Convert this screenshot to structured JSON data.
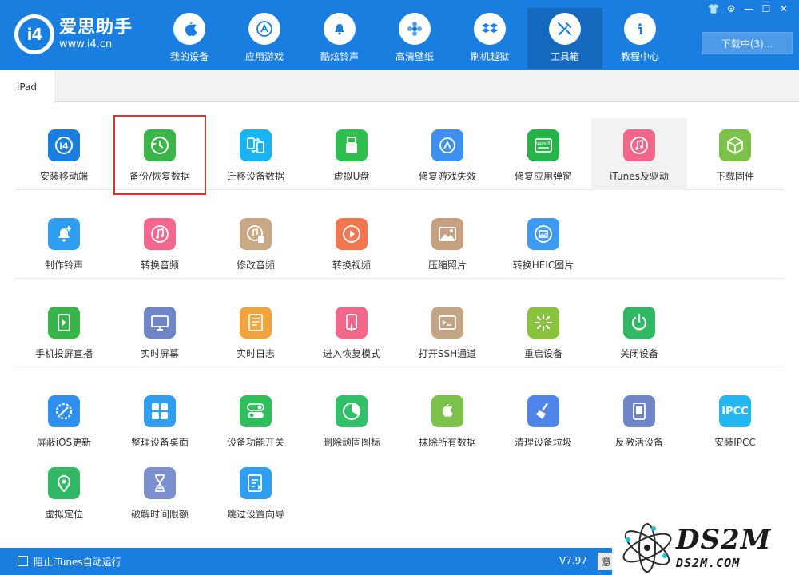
{
  "app": {
    "logo_mark": "i4",
    "name": "爱思助手",
    "url": "www.i4.cn"
  },
  "nav": [
    {
      "label": "我的设备",
      "icon": "apple-icon",
      "active": false
    },
    {
      "label": "应用游戏",
      "icon": "app-store-icon",
      "active": false
    },
    {
      "label": "酷炫铃声",
      "icon": "bell-icon",
      "active": false
    },
    {
      "label": "高清壁纸",
      "icon": "flower-icon",
      "active": false
    },
    {
      "label": "刷机越狱",
      "icon": "dropbox-icon",
      "active": false
    },
    {
      "label": "工具箱",
      "icon": "tools-icon",
      "active": true
    },
    {
      "label": "教程中心",
      "icon": "info-icon",
      "active": false
    }
  ],
  "window_controls": [
    "👕",
    "⚙",
    "—",
    "☐",
    "✕"
  ],
  "download_button": "下载中(3)...",
  "tab": "iPad",
  "tools": [
    [
      {
        "label": "安装移动端",
        "icon": "i4-app-icon",
        "color": "#1a7ee0"
      },
      {
        "label": "备份/恢复数据",
        "icon": "backup-restore-icon",
        "color": "#3bb54a",
        "selected": true
      },
      {
        "label": "迁移设备数据",
        "icon": "migrate-data-icon",
        "color": "#18b3f0"
      },
      {
        "label": "虚拟U盘",
        "icon": "usb-drive-icon",
        "color": "#2fbf4f"
      },
      {
        "label": "修复游戏失效",
        "icon": "repair-app-icon",
        "color": "#3d8ff0"
      },
      {
        "label": "修复应用弹窗",
        "icon": "apple-id-icon",
        "color": "#28b24a"
      },
      {
        "label": "iTunes及驱动",
        "icon": "itunes-icon",
        "color": "#f2668b",
        "hover": true
      },
      {
        "label": "下载固件",
        "icon": "cube-icon",
        "color": "#7cc24a"
      }
    ],
    [
      {
        "label": "制作铃声",
        "icon": "bell-plus-icon",
        "color": "#2f9ef0"
      },
      {
        "label": "转换音频",
        "icon": "music-icon",
        "color": "#f4678f"
      },
      {
        "label": "修改音频",
        "icon": "music-edit-icon",
        "color": "#c9a886"
      },
      {
        "label": "转换视频",
        "icon": "video-play-icon",
        "color": "#f0774f"
      },
      {
        "label": "压缩照片",
        "icon": "photo-icon",
        "color": "#c7a17f"
      },
      {
        "label": "转换HEIC图片",
        "icon": "heic-photo-icon",
        "color": "#3f9bf0"
      }
    ],
    [
      {
        "label": "手机投屏直播",
        "icon": "screen-cast-icon",
        "color": "#37b54a"
      },
      {
        "label": "实时屏幕",
        "icon": "monitor-icon",
        "color": "#6f86c9"
      },
      {
        "label": "实时日志",
        "icon": "log-icon",
        "color": "#f2a43c"
      },
      {
        "label": "进入恢复模式",
        "icon": "recovery-mode-icon",
        "color": "#f3678a"
      },
      {
        "label": "打开SSH通道",
        "icon": "ssh-terminal-icon",
        "color": "#c3a585"
      },
      {
        "label": "重启设备",
        "icon": "restart-icon",
        "color": "#8ac43f"
      },
      {
        "label": "关闭设备",
        "icon": "power-icon",
        "color": "#30b864"
      }
    ],
    [
      {
        "label": "屏蔽iOS更新",
        "icon": "block-update-icon",
        "color": "#2f8ff0"
      },
      {
        "label": "整理设备桌面",
        "icon": "grid-icon",
        "color": "#2f9ef0"
      },
      {
        "label": "设备功能开关",
        "icon": "toggle-icon",
        "color": "#2fbf5a"
      },
      {
        "label": "删除顽固图标",
        "icon": "pie-icon",
        "color": "#30c06a"
      },
      {
        "label": "抹除所有数据",
        "icon": "apple-erase-icon",
        "color": "#7cc24a"
      },
      {
        "label": "清理设备垃圾",
        "icon": "broom-icon",
        "color": "#4f85e8"
      },
      {
        "label": "反激活设备",
        "icon": "deactivate-icon",
        "color": "#6f86c9"
      },
      {
        "label": "安装IPCC",
        "icon": "ipcc-icon",
        "color": "#24b8f0",
        "text": "IPCC"
      }
    ],
    [
      {
        "label": "虚拟定位",
        "icon": "location-pin-icon",
        "color": "#30b864"
      },
      {
        "label": "破解时间限额",
        "icon": "hourglass-icon",
        "color": "#7b8fd0"
      },
      {
        "label": "跳过设置向导",
        "icon": "skip-setup-icon",
        "color": "#2f9ef0"
      }
    ]
  ],
  "footer": {
    "checkbox_label": "阻止iTunes自动运行",
    "version": "V7.97",
    "button": "意"
  },
  "watermark": {
    "main": "DS2M",
    "sub": "DS2M.COM"
  }
}
